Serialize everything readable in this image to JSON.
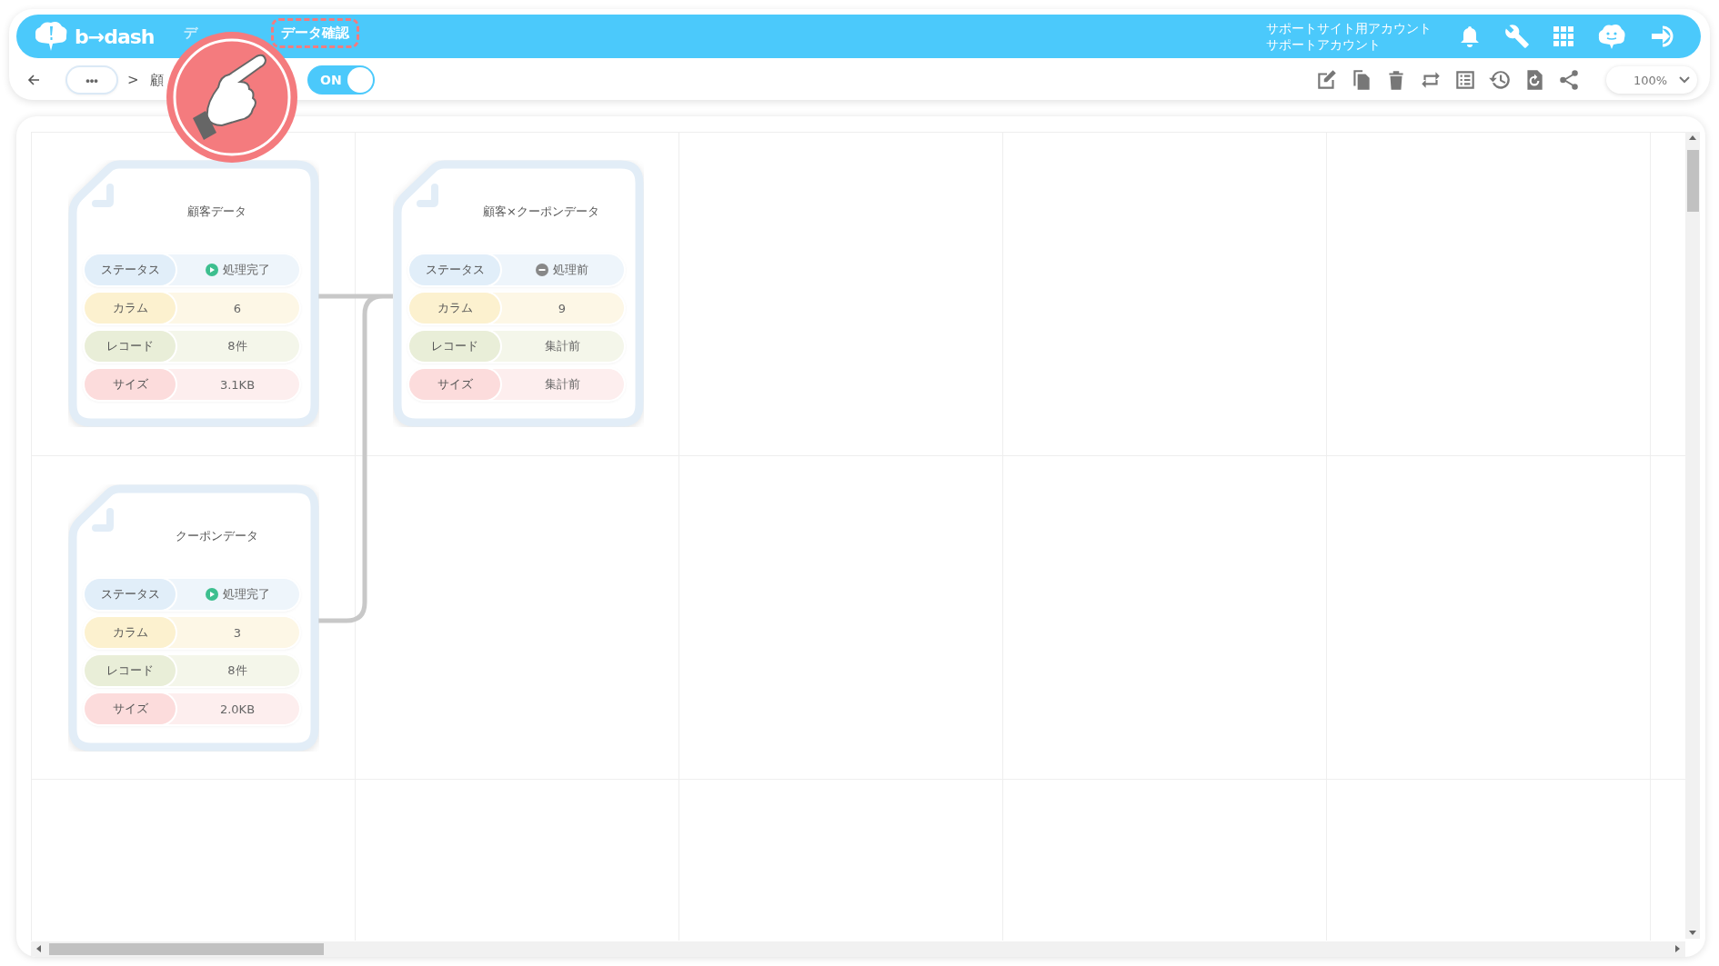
{
  "header": {
    "logo": "b→dash",
    "menu": [
      {
        "label": "デ",
        "selected": false,
        "highlighted": false
      },
      {
        "label": "データ確認",
        "selected": true,
        "highlighted": true
      }
    ],
    "account": [
      "サポートサイト用アカウント",
      "サポートアカウント"
    ]
  },
  "toolbar": {
    "more": "•••",
    "separator": ">",
    "breadcrumb": "顧",
    "toggle": {
      "label": "ON",
      "on": true
    },
    "zoom": "100%"
  },
  "nodes": [
    {
      "title": "顧客データ",
      "rows": [
        {
          "kind": "status_done",
          "label": "ステータス",
          "value": "処理完了"
        },
        {
          "kind": "column",
          "label": "カラム",
          "value": "6"
        },
        {
          "kind": "record",
          "label": "レコード",
          "value": "8件"
        },
        {
          "kind": "size",
          "label": "サイズ",
          "value": "3.1KB"
        }
      ]
    },
    {
      "title": "顧客×クーポンデータ",
      "rows": [
        {
          "kind": "status_pending",
          "label": "ステータス",
          "value": "処理前"
        },
        {
          "kind": "column",
          "label": "カラム",
          "value": "9"
        },
        {
          "kind": "record",
          "label": "レコード",
          "value": "集計前"
        },
        {
          "kind": "size",
          "label": "サイズ",
          "value": "集計前"
        }
      ]
    },
    {
      "title": "クーポンデータ",
      "rows": [
        {
          "kind": "status_done",
          "label": "ステータス",
          "value": "処理完了"
        },
        {
          "kind": "column",
          "label": "カラム",
          "value": "3"
        },
        {
          "kind": "record",
          "label": "レコード",
          "value": "8件"
        },
        {
          "kind": "size",
          "label": "サイズ",
          "value": "2.0KB"
        }
      ]
    }
  ]
}
